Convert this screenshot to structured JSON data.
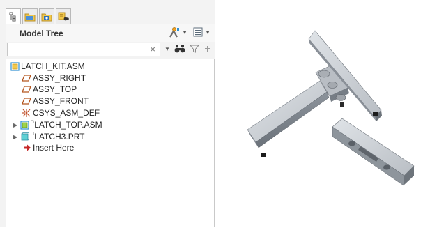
{
  "panel": {
    "title": "Model Tree",
    "tabs": [
      {
        "name": "model-tree-tab",
        "icon": "tree-icon",
        "active": true
      },
      {
        "name": "folder-browser-tab",
        "icon": "folder-icon",
        "active": false
      },
      {
        "name": "favorites-tab",
        "icon": "favorites-icon",
        "active": false
      },
      {
        "name": "layers-tab",
        "icon": "search-tools-icon",
        "active": false
      }
    ],
    "header_tools": [
      "settings-icon",
      "show-icon"
    ]
  },
  "search": {
    "value": "",
    "placeholder": ""
  },
  "tree": {
    "items": [
      {
        "label": "LATCH_KIT.ASM",
        "icon": "assembly-icon",
        "level": 0
      },
      {
        "label": "ASSY_RIGHT",
        "icon": "datum-plane-icon",
        "level": 1
      },
      {
        "label": "ASSY_TOP",
        "icon": "datum-plane-icon",
        "level": 1
      },
      {
        "label": "ASSY_FRONT",
        "icon": "datum-plane-icon",
        "level": 1
      },
      {
        "label": "CSYS_ASM_DEF",
        "icon": "csys-icon",
        "level": 1
      },
      {
        "label": "LATCH_TOP.ASM",
        "icon": "subassembly-icon",
        "level": 1,
        "expandable": true
      },
      {
        "label": "LATCH3.PRT",
        "icon": "part-icon",
        "level": 1,
        "expandable": true
      },
      {
        "label": "Insert Here",
        "icon": "insert-arrow-icon",
        "level": 1
      }
    ]
  },
  "colors": {
    "accent": "#2e8fd1",
    "insert": "#c62828",
    "datum": "#b5561f",
    "part_body": "#c9cdd2"
  }
}
